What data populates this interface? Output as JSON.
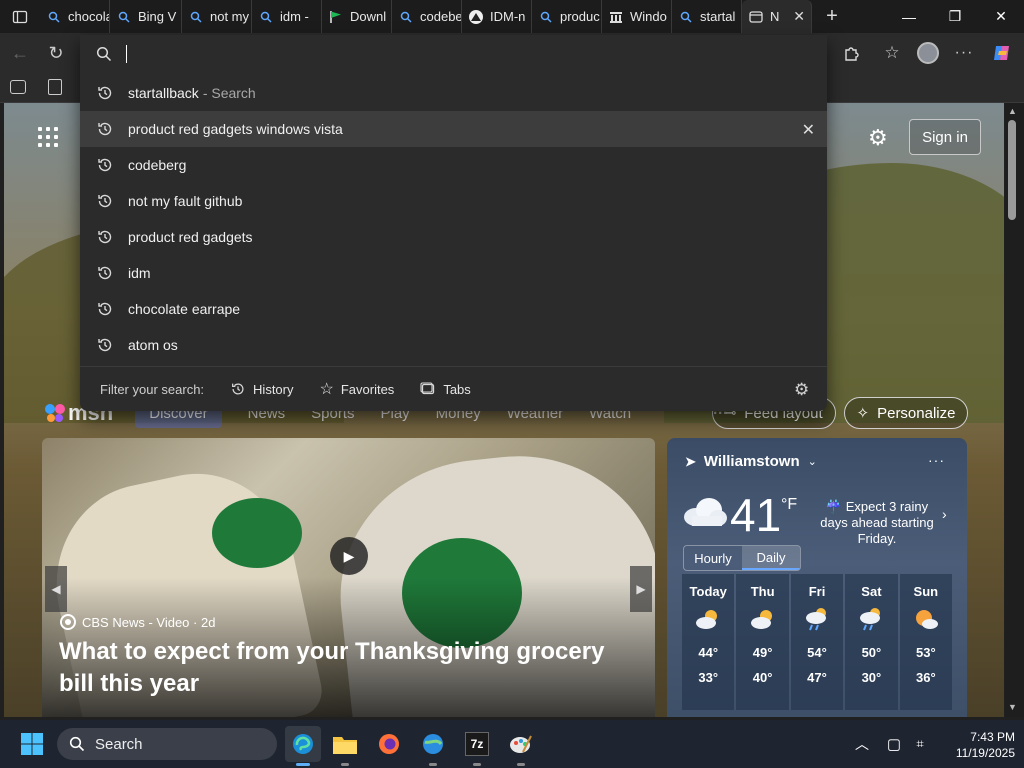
{
  "tabs": [
    {
      "label": "chocola",
      "icon": "search-icon"
    },
    {
      "label": "Bing V",
      "icon": "search-icon"
    },
    {
      "label": "not my",
      "icon": "search-icon"
    },
    {
      "label": "idm - ",
      "icon": "search-icon"
    },
    {
      "label": "Downl",
      "icon": "flag-icon"
    },
    {
      "label": "codebe",
      "icon": "search-icon"
    },
    {
      "label": "IDM-n",
      "icon": "mountain-icon"
    },
    {
      "label": "produc",
      "icon": "search-icon"
    },
    {
      "label": "Windo",
      "icon": "building-icon"
    },
    {
      "label": "startal",
      "icon": "search-icon"
    },
    {
      "label": "N",
      "icon": "newtab-icon"
    }
  ],
  "omnibox": {
    "value": "",
    "placeholder": ""
  },
  "suggestions": [
    {
      "text": "startallback",
      "suffix": "- Search"
    },
    {
      "text": "product red gadgets windows vista",
      "suffix": ""
    },
    {
      "text": "codeberg",
      "suffix": ""
    },
    {
      "text": "not my fault github",
      "suffix": ""
    },
    {
      "text": "product red gadgets",
      "suffix": ""
    },
    {
      "text": "idm",
      "suffix": ""
    },
    {
      "text": "chocolate earrape",
      "suffix": ""
    },
    {
      "text": "atom os",
      "suffix": ""
    }
  ],
  "filter": {
    "label": "Filter your search:",
    "history": "History",
    "favorites": "Favorites",
    "tabs": "Tabs"
  },
  "msn": {
    "sign_in": "Sign in",
    "logo": "msn",
    "nav": [
      "Discover",
      "News",
      "Sports",
      "Play",
      "Money",
      "Weather",
      "Watch"
    ],
    "more": "···",
    "feed_layout": "Feed layout",
    "personalize": "Personalize"
  },
  "hero": {
    "source": "CBS News - Video · 2d",
    "title": "What to expect from your Thanksgiving grocery bill this year"
  },
  "weather": {
    "location": "Williamstown",
    "temp": "41",
    "unit": "°F",
    "alert": "Expect 3 rainy days ahead starting Friday.",
    "toggle": {
      "hourly": "Hourly",
      "daily": "Daily"
    },
    "forecast": [
      {
        "day": "Today",
        "hi": "44°",
        "lo": "33°",
        "icon": "partly-cloudy-icon"
      },
      {
        "day": "Thu",
        "hi": "49°",
        "lo": "40°",
        "icon": "partly-cloudy-icon"
      },
      {
        "day": "Fri",
        "hi": "54°",
        "lo": "47°",
        "icon": "rain-icon"
      },
      {
        "day": "Sat",
        "hi": "50°",
        "lo": "30°",
        "icon": "rain-icon"
      },
      {
        "day": "Sun",
        "hi": "53°",
        "lo": "36°",
        "icon": "partly-sunny-icon"
      }
    ]
  },
  "taskbar": {
    "search": "Search",
    "time": "7:43 PM",
    "date": "11/19/2025"
  },
  "colors": {
    "accent": "#60aef5",
    "dropdown_bg": "#2b2b2b",
    "highlight": "#3d3d3d"
  }
}
